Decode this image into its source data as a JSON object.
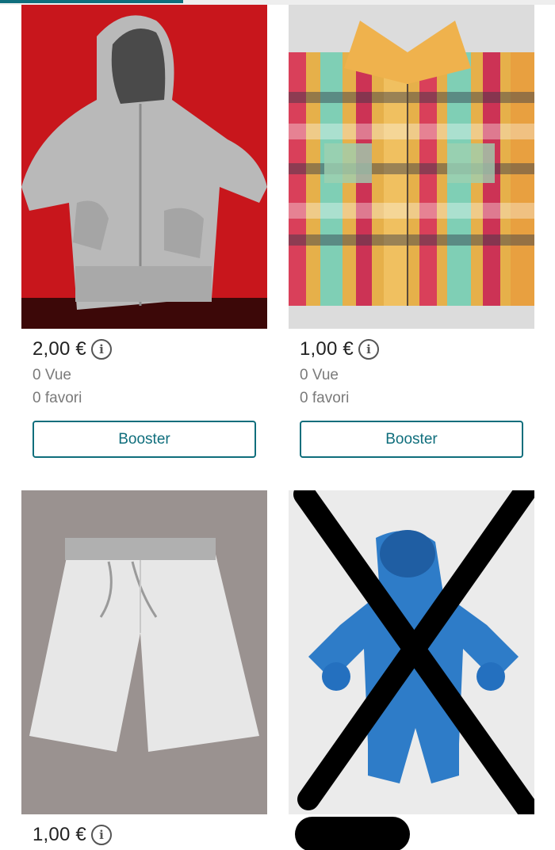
{
  "colors": {
    "accent": "#0f6e7c",
    "muted_text": "#7a7a7a"
  },
  "top_progress": {
    "fraction": 0.33
  },
  "items": [
    {
      "image": "grey-zip-hoodie-photo",
      "price": "2,00 €",
      "views": "0 Vue",
      "favorites": "0 favori",
      "boost_label": "Booster",
      "info_icon": "info-icon"
    },
    {
      "image": "plaid-shirt-photo",
      "price": "1,00 €",
      "views": "0 Vue",
      "favorites": "0 favori",
      "boost_label": "Booster",
      "info_icon": "info-icon"
    },
    {
      "image": "white-shorts-photo",
      "price": "1,00 €",
      "info_icon": "info-icon"
    },
    {
      "image": "blue-snowsuit-crossed-out-photo"
    }
  ]
}
